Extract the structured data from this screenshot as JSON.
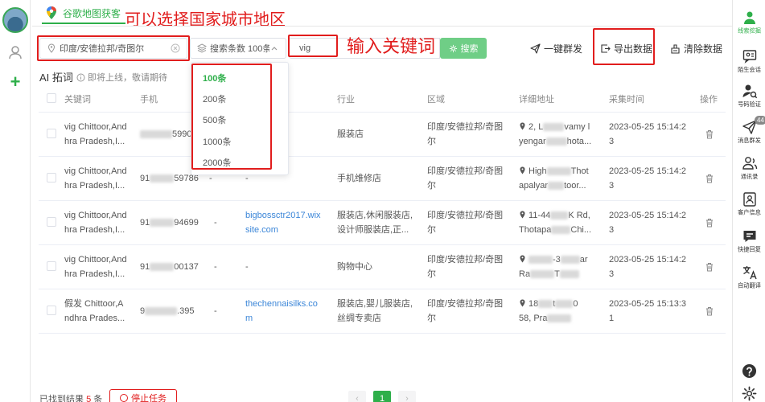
{
  "header": {
    "tab_title": "谷歌地图获客"
  },
  "annotations": {
    "region_tip": "可以选择国家城市地区",
    "keyword_tip": "输入关键词"
  },
  "toolbar": {
    "region_value": "印度/安德拉邦/奇图尔",
    "count_value": "搜索条数 100条",
    "keyword_value": "vig",
    "search_label": "搜索",
    "broadcast_label": "一键群发",
    "export_label": "导出数据",
    "clear_label": "清除数据"
  },
  "dropdown": {
    "options": [
      "100条",
      "200条",
      "500条",
      "1000条",
      "2000条"
    ],
    "selected": "100条"
  },
  "ai": {
    "title": "AI 拓词",
    "hint": "即将上线，敬请期待"
  },
  "table": {
    "headers": [
      "关键词",
      "手机",
      "行业",
      "区域",
      "详细地址",
      "采集时间",
      "操作"
    ],
    "rows": [
      {
        "keyword": [
          "vig Chittoor,And",
          "hra Pradesh,I..."
        ],
        "phone_prefix": "",
        "phone_suffix": "5990",
        "website": "",
        "industry": [
          "服装店"
        ],
        "region": [
          "印度/安德拉邦/奇图",
          "尔"
        ],
        "address": [
          "2, L",
          "vamy l",
          "yengar",
          "hota..."
        ],
        "time": [
          "2023-05-25 15:14:2",
          "3"
        ]
      },
      {
        "keyword": [
          "vig Chittoor,And",
          "hra Pradesh,I..."
        ],
        "phone_prefix": "91",
        "phone_suffix": "59786",
        "email": "-",
        "website": "-",
        "industry": [
          "手机维修店"
        ],
        "region": [
          "印度/安德拉邦/奇图",
          "尔"
        ],
        "address": [
          "High",
          "Thot",
          "apalyar",
          "toor..."
        ],
        "time": [
          "2023-05-25 15:14:2",
          "3"
        ]
      },
      {
        "keyword": [
          "vig Chittoor,And",
          "hra Pradesh,I..."
        ],
        "phone_prefix": "91",
        "phone_suffix": "94699",
        "email": "-",
        "website": "bigbossctr2017.wix site.com",
        "website_lines": [
          "bigbossctr2017.wix",
          "site.com"
        ],
        "industry": [
          "服装店,休闲服装店,",
          "设计师服装店,正..."
        ],
        "region": [
          "印度/安德拉邦/奇图",
          "尔"
        ],
        "address": [
          "11-44",
          "K Rd,",
          "Thotapa",
          "Chi..."
        ],
        "time": [
          "2023-05-25 15:14:2",
          "3"
        ]
      },
      {
        "keyword": [
          "vig Chittoor,And",
          "hra Pradesh,I..."
        ],
        "phone_prefix": "91",
        "phone_suffix": "00137",
        "email": "-",
        "website": "-",
        "industry": [
          "购物中心"
        ],
        "region": [
          "印度/安德拉邦/奇图",
          "尔"
        ],
        "address": [
          "-3",
          "ar",
          "Ra",
          "T"
        ],
        "time": [
          "2023-05-25 15:14:2",
          "3"
        ]
      },
      {
        "keyword": [
          "假发 Chittoor,A",
          "ndhra Prades..."
        ],
        "phone_prefix": "9",
        "phone_suffix": ".395",
        "email": "-",
        "website": "thechennaisilks.com",
        "website_lines": [
          "thechennaisilks.co",
          "m"
        ],
        "industry": [
          "服装店,婴儿服装店,",
          "丝绸专卖店"
        ],
        "region": [
          "印度/安德拉邦/奇图",
          "尔"
        ],
        "address": [
          "18",
          "t",
          "0",
          "58, Pra"
        ],
        "time": [
          "2023-05-25 15:13:3",
          "1"
        ]
      }
    ]
  },
  "footer": {
    "found_prefix": "已找到结果",
    "found_count": "5",
    "found_suffix": "条",
    "stop_label": "停止任务",
    "page": "1",
    "prev": "‹",
    "next": "›"
  },
  "right_rail": {
    "items": [
      "线索挖掘",
      "陌生会话",
      "号码验证",
      "消息群发",
      "通讯录",
      "客户信息",
      "快捷回复",
      "自动翻译"
    ],
    "badge": "44"
  },
  "colors": {
    "accent": "#2eaf4a",
    "annotation": "#e11d1d",
    "link": "#3b86d8"
  },
  "icons": [
    "map-pin-icon",
    "layers-icon",
    "clear-icon",
    "chevron-up-icon",
    "search-icon",
    "send-icon",
    "export-icon",
    "clear-data-icon",
    "info-icon",
    "trash-icon",
    "help-icon",
    "settings-icon"
  ]
}
